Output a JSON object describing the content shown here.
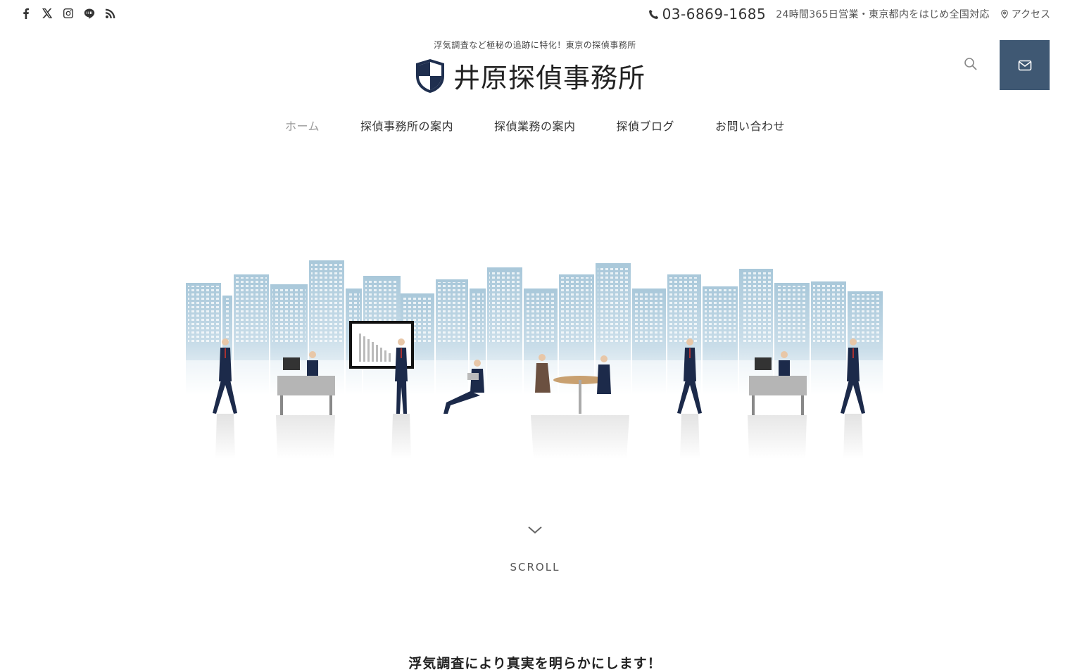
{
  "social": [
    {
      "icon": "facebook-icon"
    },
    {
      "icon": "x-icon"
    },
    {
      "icon": "instagram-icon"
    },
    {
      "icon": "line-icon"
    },
    {
      "icon": "rss-icon"
    }
  ],
  "contact": {
    "phone": "03-6869-1685",
    "hours": "24時間365日営業・東京都内をはじめ全国対応",
    "access": "アクセス"
  },
  "header": {
    "tagline": "浮気調査など極秘の追跡に特化！東京の探偵事務所",
    "site_name": "井原探偵事務所"
  },
  "nav": {
    "items": [
      {
        "label": "ホーム",
        "active": true
      },
      {
        "label": "探偵事務所の案内"
      },
      {
        "label": "探偵業務の案内"
      },
      {
        "label": "探偵ブログ"
      },
      {
        "label": "お問い合わせ"
      }
    ]
  },
  "scroll": {
    "label": "SCROLL"
  },
  "main": {
    "headline": "浮気調査により真実を明らかにします！"
  },
  "colors": {
    "accent": "#3f5873",
    "sky": "#a9c8da",
    "suit": "#1c2a4a"
  }
}
